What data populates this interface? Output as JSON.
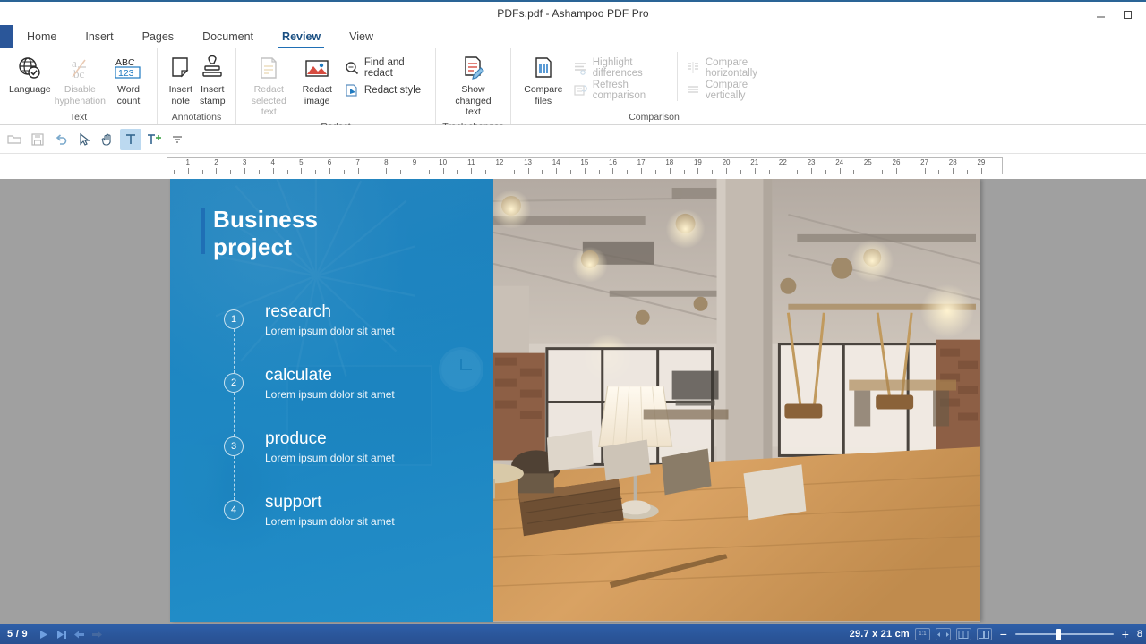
{
  "window": {
    "title": "PDFs.pdf - Ashampoo PDF Pro",
    "minimize_label": "minimize",
    "maximize_label": "maximize"
  },
  "tabs": [
    {
      "label": "Home",
      "active": false
    },
    {
      "label": "Insert",
      "active": false
    },
    {
      "label": "Pages",
      "active": false
    },
    {
      "label": "Document",
      "active": false
    },
    {
      "label": "Review",
      "active": true
    },
    {
      "label": "View",
      "active": false
    }
  ],
  "ribbon": {
    "groups": [
      {
        "title": "Text",
        "buttons": [
          {
            "label": "Language",
            "icon": "globe-check-icon",
            "disabled": false,
            "caret": false
          },
          {
            "label": "Disable\nhyphenation",
            "icon": "hyphenation-icon",
            "disabled": true,
            "caret": false
          },
          {
            "label": "Word\ncount",
            "icon": "abc-123-icon",
            "disabled": false,
            "caret": false
          }
        ]
      },
      {
        "title": "Annotations",
        "buttons": [
          {
            "label": "Insert\nnote",
            "icon": "note-icon",
            "disabled": false,
            "caret": true
          },
          {
            "label": "Insert\nstamp",
            "icon": "stamp-icon",
            "disabled": false,
            "caret": true
          }
        ]
      },
      {
        "title": "Redact",
        "buttons": [
          {
            "label": "Redact\nselected text",
            "icon": "redact-text-icon",
            "disabled": true,
            "caret": false
          },
          {
            "label": "Redact\nimage",
            "icon": "redact-image-icon",
            "disabled": false,
            "caret": false
          }
        ],
        "small_buttons": [
          {
            "label": "Find and redact",
            "icon": "magnifier-icon",
            "disabled": false
          },
          {
            "label": "Redact style",
            "icon": "redact-style-icon",
            "disabled": false
          }
        ]
      },
      {
        "title": "Track changes",
        "buttons": [
          {
            "label": "Show\nchanged text",
            "icon": "show-changed-text-icon",
            "disabled": false,
            "caret": true
          }
        ]
      },
      {
        "title": "Comparison",
        "buttons": [
          {
            "label": "Compare\nfiles",
            "icon": "compare-files-icon",
            "disabled": false,
            "caret": true
          }
        ],
        "small_buttons": [
          {
            "label": "Highlight differences",
            "icon": "highlight-differences-icon",
            "disabled": true
          },
          {
            "label": "Refresh comparison",
            "icon": "refresh-comparison-icon",
            "disabled": true
          }
        ],
        "small_buttons2": [
          {
            "label": "Compare horizontally",
            "icon": "compare-horizontally-icon",
            "disabled": true
          },
          {
            "label": "Compare vertically",
            "icon": "compare-vertically-icon",
            "disabled": true
          }
        ]
      }
    ]
  },
  "quickbar": {
    "items": [
      {
        "name": "open-icon",
        "selected": false
      },
      {
        "name": "save-icon",
        "selected": false
      },
      {
        "name": "undo-icon",
        "selected": false
      },
      {
        "name": "select-cursor-icon",
        "selected": false
      },
      {
        "name": "hand-pan-icon",
        "selected": false
      },
      {
        "name": "text-tool-icon",
        "selected": true
      },
      {
        "name": "add-text-icon",
        "selected": false
      },
      {
        "name": "text-align-icon",
        "selected": false
      }
    ]
  },
  "ruler": {
    "unit": "cm",
    "max": 29,
    "labels": [
      1,
      2,
      3,
      4,
      5,
      6,
      7,
      8,
      9,
      10,
      11,
      12,
      13,
      14,
      15,
      16,
      17,
      18,
      19,
      20,
      21,
      22,
      23,
      24,
      25,
      26,
      27,
      28,
      29
    ]
  },
  "document": {
    "title": "Business\nproject",
    "steps": [
      {
        "num": "1",
        "title": "research",
        "sub": "Lorem ipsum dolor sit amet"
      },
      {
        "num": "2",
        "title": "calculate",
        "sub": "Lorem ipsum dolor sit amet"
      },
      {
        "num": "3",
        "title": "produce",
        "sub": "Lorem ipsum dolor sit amet"
      },
      {
        "num": "4",
        "title": "support",
        "sub": "Lorem ipsum dolor sit amet"
      }
    ],
    "photo_alt": "industrial-loft-interior-photo"
  },
  "status": {
    "page_current": 5,
    "page_total": 9,
    "page_label": "5 / 9",
    "page_size": "29.7 x 21 cm",
    "view_modes": [
      "1:1",
      "fit-width",
      "single-page",
      "two-page"
    ],
    "zoom_minus": "−",
    "zoom_plus": "+",
    "zoom_value": "8"
  },
  "colors": {
    "accent": "#1f6fb5",
    "ribbon_active": "#1a4f82",
    "statusbar": "#2b5ca8",
    "doc_overlay": "#157cb9",
    "canvas_bg": "#a0a0a0"
  }
}
